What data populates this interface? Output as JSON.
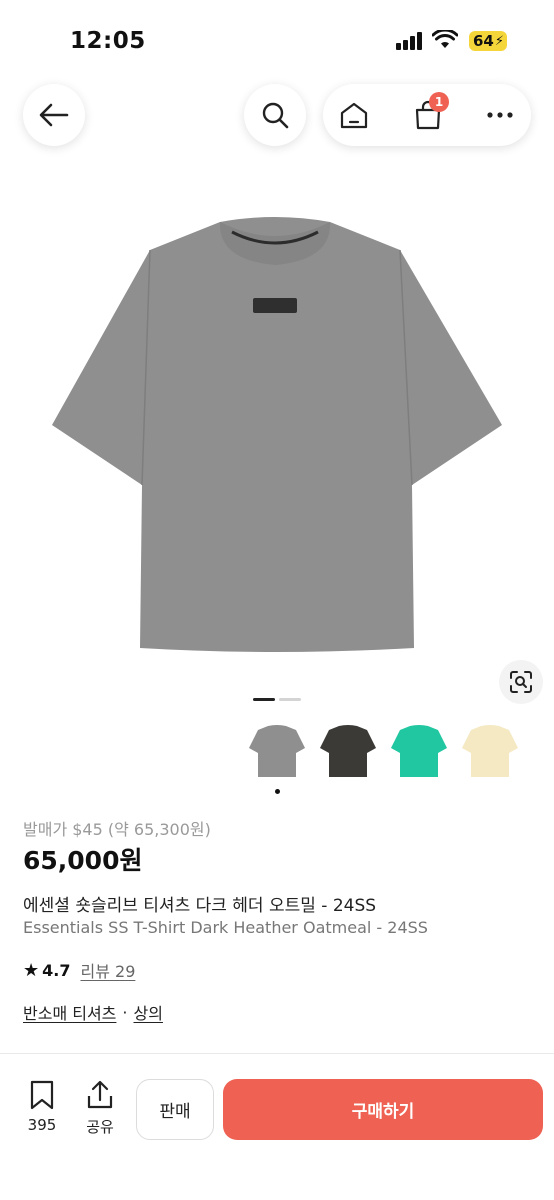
{
  "status_bar": {
    "time": "12:05",
    "battery": "64"
  },
  "nav": {
    "cart_badge": "1"
  },
  "product": {
    "release_price": "발매가 $45 (약 65,300원)",
    "price": "65,000원",
    "name_ko": "에센셜 숏슬리브 티셔츠 다크 헤더 오트밀 - 24SS",
    "name_en": "Essentials SS T-Shirt Dark Heather Oatmeal - 24SS",
    "rating": "4.7",
    "review": "리뷰 29",
    "categories": [
      "반소매 티셔츠",
      "상의"
    ],
    "category_separator": "·",
    "image_indicator": {
      "count": 2,
      "active": 0
    },
    "color_variants": [
      {
        "name": "dark-heather-oatmeal",
        "color": "#8f8f8f",
        "selected": true
      },
      {
        "name": "off-black",
        "color": "#3b3a37",
        "selected": false
      },
      {
        "name": "mint",
        "color": "#21c7a0",
        "selected": false
      },
      {
        "name": "egg-shell",
        "color": "#f4e9c3",
        "selected": false
      }
    ]
  },
  "bottom_bar": {
    "bookmark_count": "395",
    "share_label": "공유",
    "sell_label": "판매",
    "buy_label": "구매하기"
  },
  "colors": {
    "accent": "#ef6253",
    "battery": "#f5d63a",
    "shirt": "#8f8f8f"
  }
}
